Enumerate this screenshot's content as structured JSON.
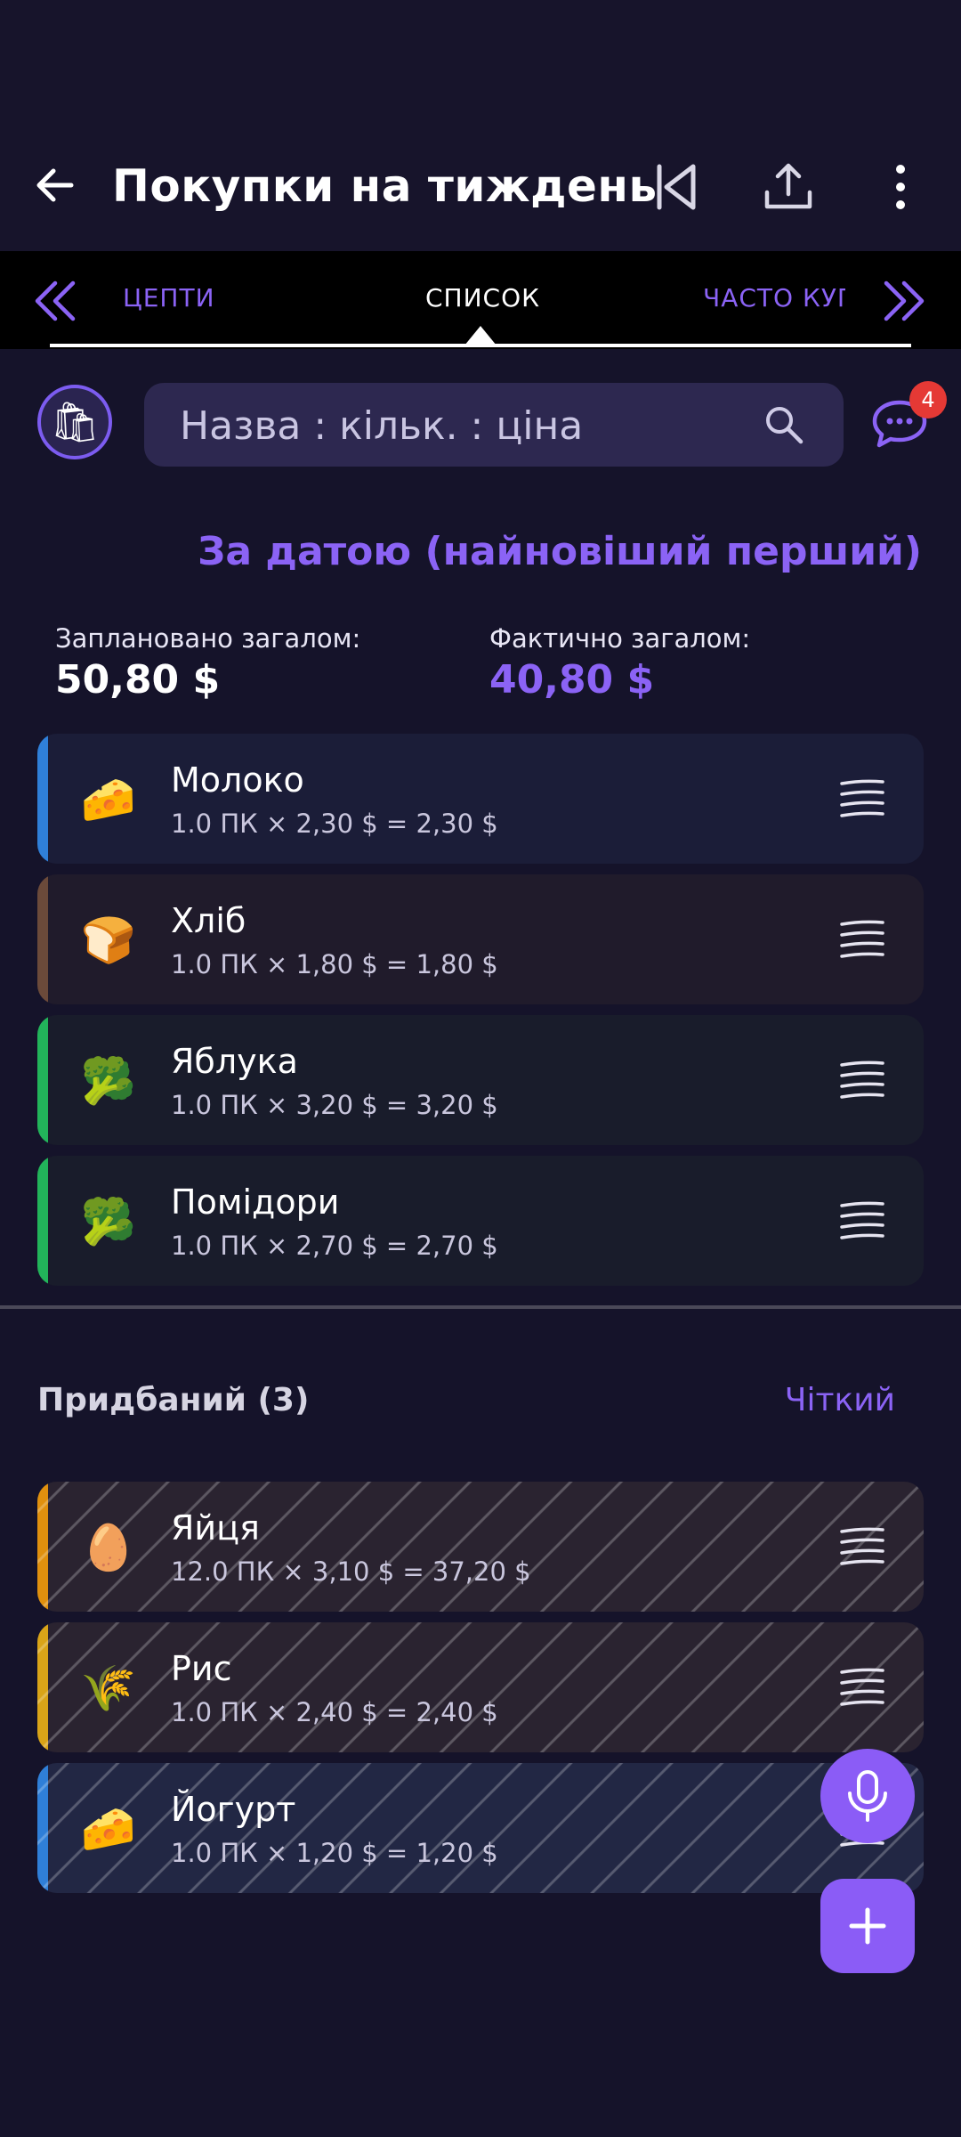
{
  "appbar": {
    "title": "Покупки на тиждень"
  },
  "tabs": {
    "left": "ЦЕПТИ",
    "active": "СПИСОК",
    "right": "ЧАСТО КУП"
  },
  "search": {
    "placeholder": "Назва : кільк. : ціна"
  },
  "chat": {
    "badge_count": "4"
  },
  "sort": {
    "label": "За датою (найновіший перший)"
  },
  "totals": {
    "planned_label": "Заплановано загалом:",
    "planned_value": "50,80 $",
    "actual_label": "Фактично загалом:",
    "actual_value": "40,80 $"
  },
  "list": [
    {
      "name": "Молоко",
      "calc": "1.0 ПК × 2,30 $ = 2,30 $",
      "emoji": "🧀",
      "stripe": "#2f7fd8",
      "bg": "#1b1d38"
    },
    {
      "name": "Хліб",
      "calc": "1.0 ПК × 1,80 $ = 1,80 $",
      "emoji": "🍞",
      "stripe": "#6b4a3a",
      "bg": "#201b2b"
    },
    {
      "name": "Яблука",
      "calc": "1.0 ПК × 3,20 $ = 3,20 $",
      "emoji": "🥦",
      "stripe": "#22b45a",
      "bg": "#191c2b"
    },
    {
      "name": "Помідори",
      "calc": "1.0 ПК × 2,70 $ = 2,70 $",
      "emoji": "🥦",
      "stripe": "#22b45a",
      "bg": "#191c2b"
    }
  ],
  "purchased": {
    "title": "Придбаний (3)",
    "clear_label": "Чіткий",
    "items": [
      {
        "name": "Яйця",
        "calc": "12.0 ПК × 3,10 $ = 37,20 $",
        "emoji": "🥚",
        "stripe": "#e0900e",
        "bg": "#2a2330"
      },
      {
        "name": "Рис",
        "calc": "1.0 ПК × 2,40 $ = 2,40 $",
        "emoji": "🌾",
        "stripe": "#d9a418",
        "bg": "#2a2330"
      },
      {
        "name": "Йогурт",
        "calc": "1.0 ПК × 1,20 $ = 1,20 $",
        "emoji": "🧀",
        "stripe": "#2f7fd8",
        "bg": "#222744"
      }
    ]
  },
  "icons": {
    "back": "arrow-left-icon",
    "first": "skip-to-first-icon",
    "share": "share-icon",
    "more": "more-vertical-icon",
    "avatar": "shopping-bags-icon",
    "search": "search-icon",
    "chat": "chat-icon",
    "mic": "microphone-icon",
    "add": "plus-icon"
  },
  "colors": {
    "accent": "#8b5cf6",
    "badge": "#e53935",
    "background": "#15132a"
  }
}
